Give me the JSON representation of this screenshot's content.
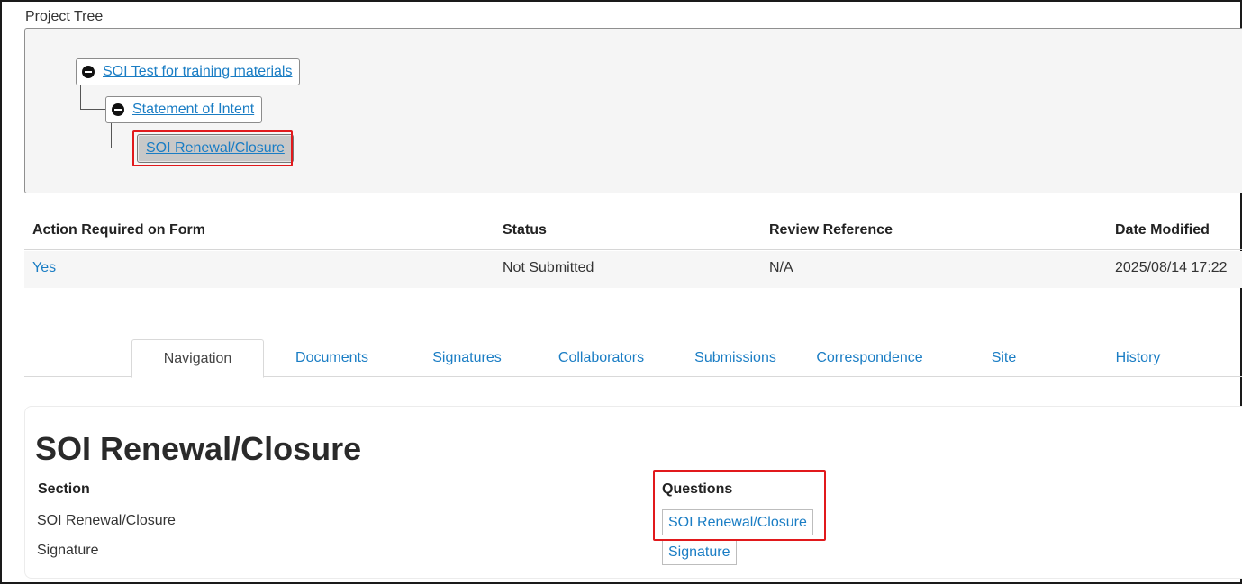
{
  "project_tree": {
    "label": "Project Tree",
    "nodes": [
      {
        "label": "SOI Test for training materials"
      },
      {
        "label": "Statement of Intent"
      },
      {
        "label": "SOI Renewal/Closure"
      }
    ]
  },
  "status_table": {
    "headers": [
      "Action Required on Form",
      "Status",
      "Review Reference",
      "Date Modified"
    ],
    "row": [
      "Yes",
      "Not Submitted",
      "N/A",
      "2025/08/14 17:22"
    ]
  },
  "tabs": [
    "Navigation",
    "Documents",
    "Signatures",
    "Collaborators",
    "Submissions",
    "Correspondence",
    "Site",
    "History"
  ],
  "active_tab": "Navigation",
  "form": {
    "title": "SOI Renewal/Closure",
    "section_header": "Section",
    "questions_header": "Questions",
    "sections": [
      "SOI Renewal/Closure",
      "Signature"
    ],
    "questions": [
      "SOI Renewal/Closure",
      "Signature"
    ]
  },
  "colors": {
    "link": "#1a7dc4",
    "highlight": "#e1191c",
    "selected_node": "#c8c8c8"
  },
  "icons": {
    "tree_toggle": "collapse-icon"
  }
}
